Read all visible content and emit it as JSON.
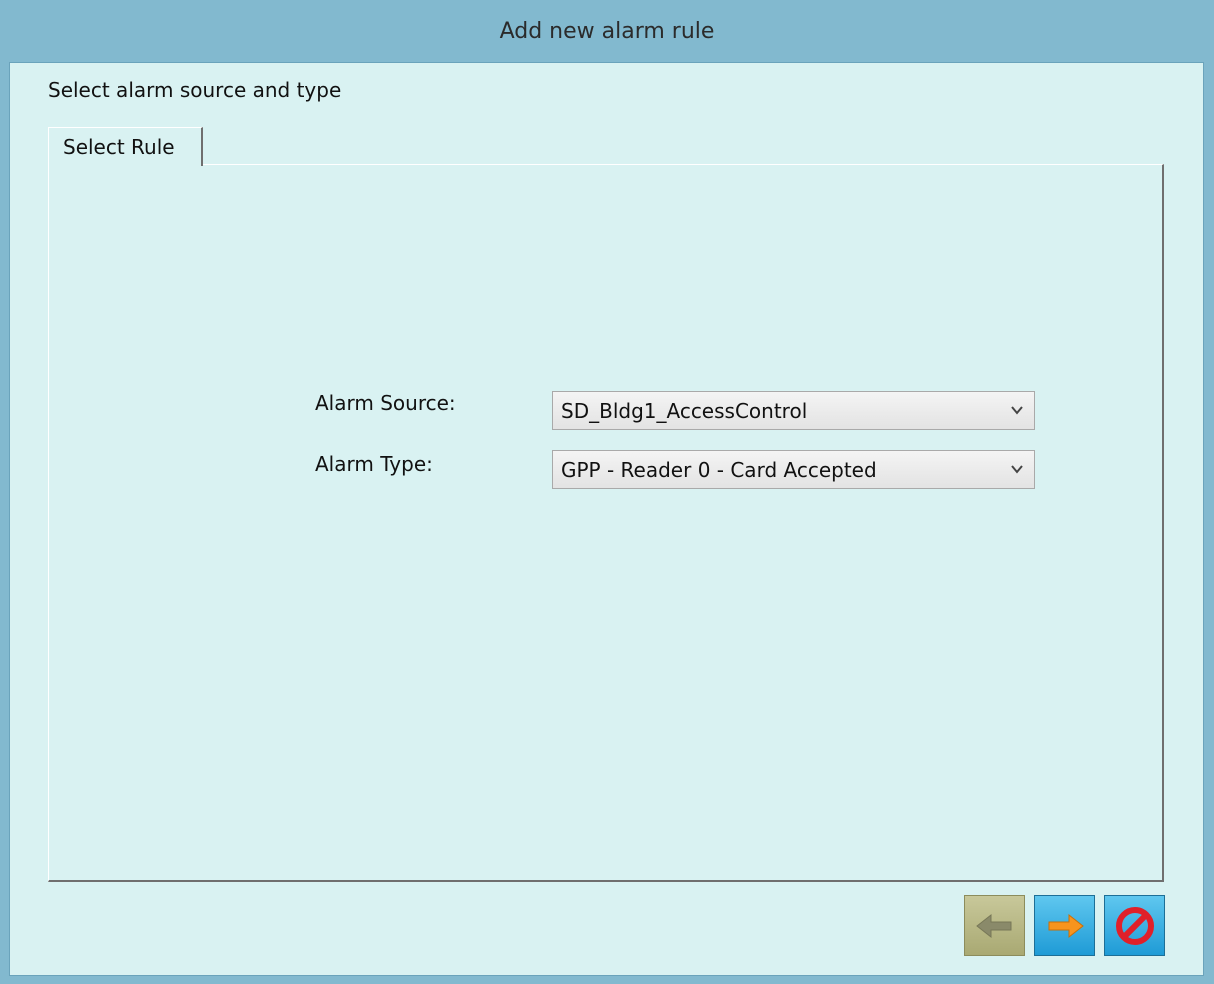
{
  "window": {
    "title": "Add new alarm rule"
  },
  "header": {
    "subtitle": "Select alarm source and type"
  },
  "tabs": [
    {
      "label": "Select Rule",
      "active": true
    }
  ],
  "form": {
    "alarm_source": {
      "label": "Alarm Source:",
      "value": "SD_Bldg1_AccessControl"
    },
    "alarm_type": {
      "label": "Alarm Type:",
      "value": "GPP - Reader 0 - Card Accepted"
    }
  },
  "buttons": {
    "back": {
      "icon": "arrow-left-icon",
      "enabled": false
    },
    "next": {
      "icon": "arrow-right-icon",
      "enabled": true
    },
    "cancel": {
      "icon": "cancel-icon",
      "enabled": true
    }
  },
  "colors": {
    "titlebar": "#82b9cf",
    "client_background": "#d9f2f2",
    "next_arrow": "#f7941d",
    "cancel_red": "#e0202a"
  }
}
